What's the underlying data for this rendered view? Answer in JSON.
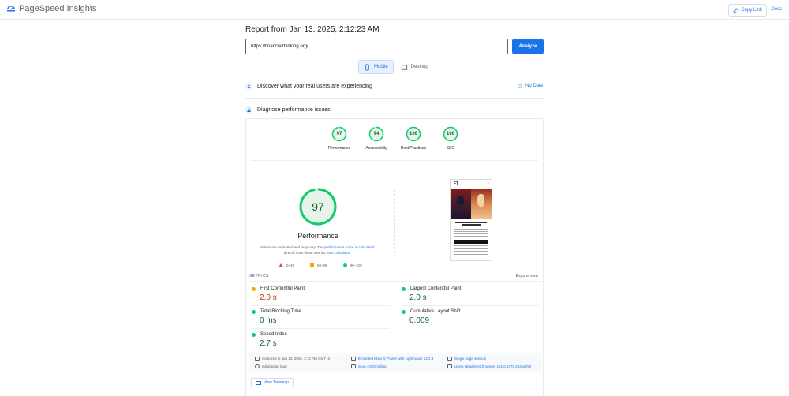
{
  "app": {
    "name": "PageSpeed Insights",
    "copy_link": "Copy Link",
    "docs": "Docs"
  },
  "report": {
    "title": "Report from Jan 13, 2025, 2:12:23 AM",
    "url": "https://financialthinking.org/",
    "analyze": "Analyze"
  },
  "device_tabs": {
    "mobile": "Mobile",
    "desktop": "Desktop"
  },
  "sections": {
    "discover": "Discover what your real users are experiencing",
    "no_data": "No Data",
    "diagnose": "Diagnose performance issues"
  },
  "scores": [
    {
      "label": "Performance",
      "value": "97",
      "pct": 0.97
    },
    {
      "label": "Accessibility",
      "value": "94",
      "pct": 0.94
    },
    {
      "label": "Best Practices",
      "value": "100",
      "pct": 1.0
    },
    {
      "label": "SEO",
      "value": "100",
      "pct": 1.0
    }
  ],
  "performance": {
    "score": "97",
    "title": "Performance",
    "note_prefix": "Values are estimated and may vary. The ",
    "note_link1": "performance score is calculated",
    "note_mid": " directly from these metrics. ",
    "note_link2": "See calculator."
  },
  "legend": {
    "bad": "0–49",
    "avg": "50–89",
    "good": "90–100"
  },
  "screenshot": {
    "logo": "FT",
    "close": "×"
  },
  "metrics": {
    "label": "METRICS",
    "expand": "Expand view",
    "fcp": {
      "name": "First Contentful Paint",
      "value": "2.0 s"
    },
    "lcp": {
      "name": "Largest Contentful Paint",
      "value": "2.0 s"
    },
    "tbt": {
      "name": "Total Blocking Time",
      "value": "0 ms"
    },
    "cls": {
      "name": "Cumulative Layout Shift",
      "value": "0.009"
    },
    "si": {
      "name": "Speed Index",
      "value": "2.7 s"
    }
  },
  "env": {
    "captured": "Captured at Jan 13, 2025, 2:12 AM GMT+2",
    "initial": "Initial page load",
    "device": "Emulated Moto G Power with Lighthouse 12.2.3",
    "throttle": "Slow 4G throttling",
    "session": "Single page session",
    "browser": "Using HeadlessChromium 131.0.6778.204 with lr"
  },
  "treemap": "View Treemap",
  "colors": {
    "accent": "#1a73e8",
    "good": "#0cce6b",
    "avg": "#ffa400",
    "bad": "#eb4335"
  }
}
